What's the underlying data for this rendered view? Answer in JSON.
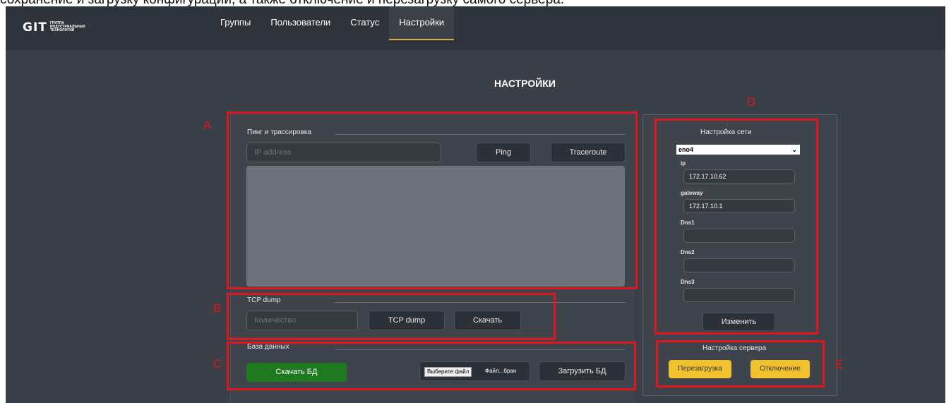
{
  "caption": "сохранение и загрузку конфигурации, а также отключение и перезагрузку самого сервера.",
  "header": {
    "logo_main": "GIT",
    "logo_sub": "ГРУППА ИНДУСТРИАЛЬНЫХ ТЕХНОЛОГИЙ",
    "nav": [
      "Группы",
      "Пользователи",
      "Статус",
      "Настройки"
    ],
    "active_nav": "Настройки"
  },
  "page": {
    "title": "НАСТРОЙКИ"
  },
  "ping": {
    "title": "Пинг и трассировка",
    "ip_placeholder": "IP address",
    "ping_label": "Ping",
    "traceroute_label": "Traceroute"
  },
  "tcp": {
    "title": "TCP dump",
    "count_placeholder": "Количество",
    "dump_label": "TCP dump",
    "download_label": "Скачать"
  },
  "db": {
    "title": "База данных",
    "download_label": "Скачать БД",
    "file_button": "Выберите файл",
    "file_text": "Файл...бран",
    "upload_label": "Загрузить БД"
  },
  "network": {
    "title": "Настройка сети",
    "interface": "eno4",
    "ip_label": "ip",
    "ip_value": "172.17.10.62",
    "gateway_label": "gateway",
    "gateway_value": "172.17.10.1",
    "dns1_label": "Dns1",
    "dns1_value": "",
    "dns2_label": "Dns2",
    "dns2_value": "",
    "dns3_label": "Dns3",
    "dns3_value": "",
    "apply_label": "Изменить"
  },
  "server": {
    "title": "Настройка сервера",
    "reboot_label": "Перезагрузка",
    "shutdown_label": "Отключение"
  },
  "annotations": {
    "a": "A",
    "b": "B",
    "c": "C",
    "d": "D",
    "e": "E",
    "box_color": "#e0161e"
  },
  "colors": {
    "header_bg": "#2f333b",
    "page_bg": "#3a3f48",
    "accent": "#d6b04a",
    "success": "#1e7a1e",
    "warning": "#f2c22e"
  }
}
